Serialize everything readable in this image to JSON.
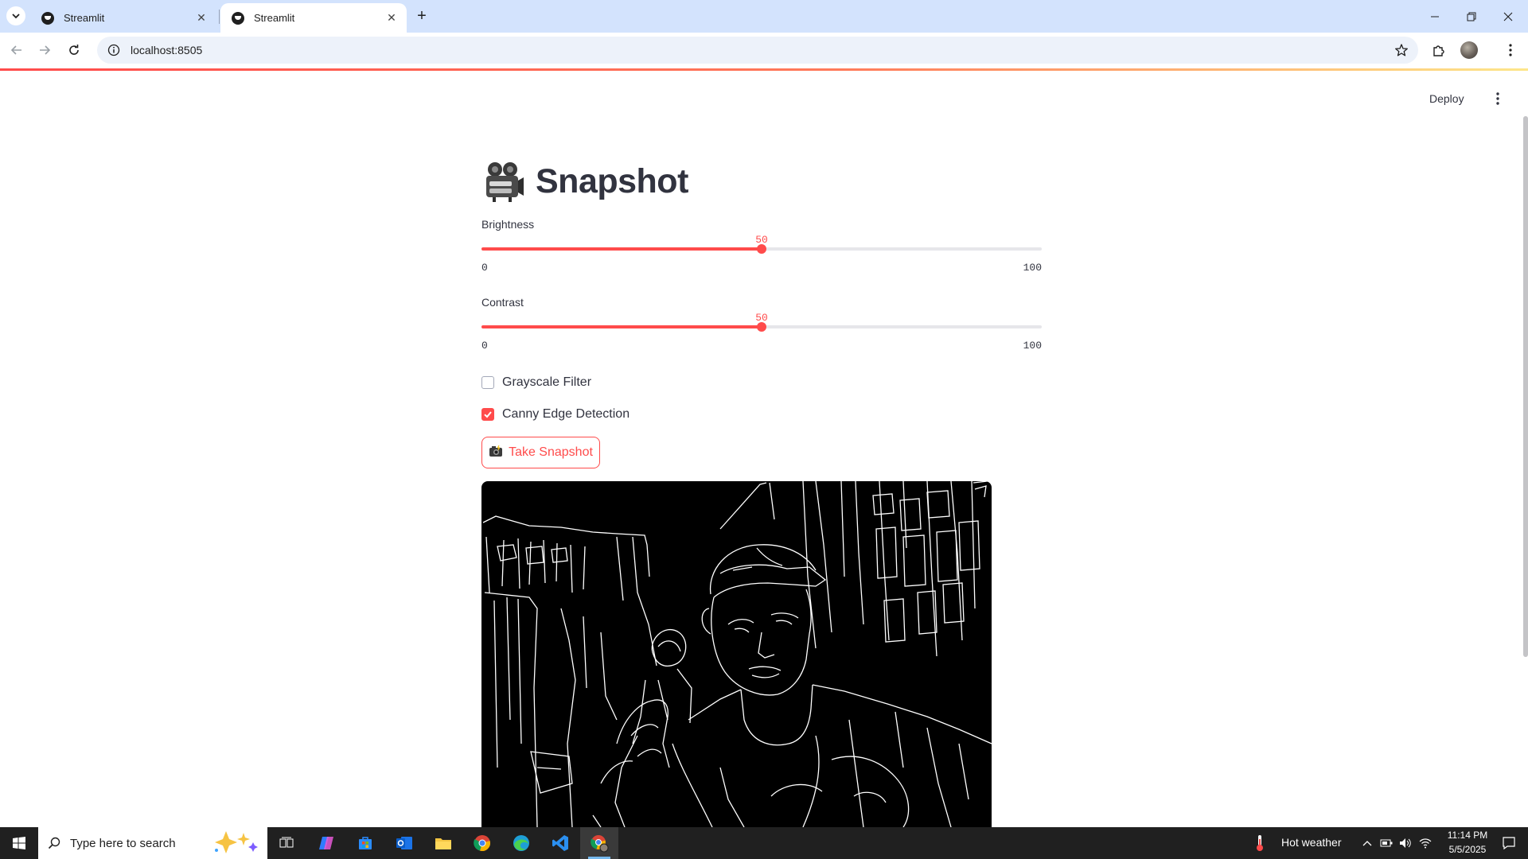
{
  "browser": {
    "tabs": [
      {
        "title": "Streamlit",
        "active": false
      },
      {
        "title": "Streamlit",
        "active": true
      }
    ],
    "url": "localhost:8505"
  },
  "app": {
    "deploy_label": "Deploy",
    "title": "Snapshot",
    "title_icon": "movie-camera-icon",
    "accent_color": "#ff4b4b",
    "sliders": [
      {
        "label": "Brightness",
        "value": 50,
        "min": 0,
        "max": 100,
        "value_text": "50",
        "min_text": "0",
        "max_text": "100"
      },
      {
        "label": "Contrast",
        "value": 50,
        "min": 0,
        "max": 100,
        "value_text": "50",
        "min_text": "0",
        "max_text": "100"
      }
    ],
    "checkboxes": [
      {
        "label": "Grayscale Filter",
        "checked": false
      },
      {
        "label": "Canny Edge Detection",
        "checked": true
      }
    ],
    "snapshot_button": {
      "label": "Take Snapshot",
      "icon": "camera-with-flash-icon"
    }
  },
  "taskbar": {
    "search_placeholder": "Type here to search",
    "weather": "Hot weather",
    "time": "11:14 PM",
    "date": "5/5/2025"
  }
}
